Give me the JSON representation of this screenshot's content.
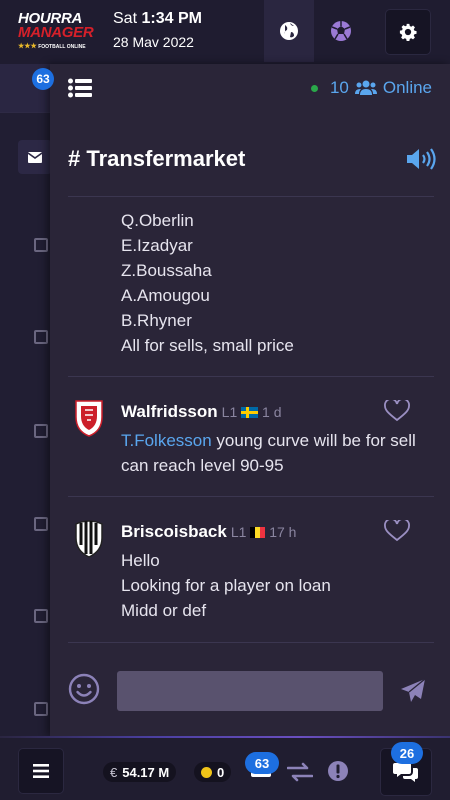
{
  "header": {
    "logo_line1": "HOURRA",
    "logo_line2": "MANAGER",
    "logo_tagline": "FOOTBALL ONLINE",
    "day": "Sat",
    "time": "1:34 PM",
    "date": "28 Mav 2022"
  },
  "sidebar": {
    "badge": "63"
  },
  "chat": {
    "online_count": "10",
    "online_label": "Online",
    "channel_title": "# Transfermarket",
    "messages": [
      {
        "lines": [
          {
            "text": "Q.Oberlin",
            "link": true
          },
          {
            "text": "E.Izadyar",
            "link": true
          },
          {
            "text": "Z.Boussaha",
            "link": true
          },
          {
            "text": "A.Amougou",
            "link": true
          },
          {
            "text": "B.Rhyner",
            "link": true
          },
          {
            "text": "All for sells, small price",
            "link": false
          }
        ]
      },
      {
        "author": "Walfridsson",
        "league": "L1",
        "flag": "sweden",
        "age": "1 d",
        "line1_link": "T.Folkesson",
        "line1_rest": " young curve will be for sell",
        "line2": "can reach level 90-95"
      },
      {
        "author": "Briscoisback",
        "league": "L1",
        "flag": "belgium",
        "age": "17 h",
        "line1": "Hello",
        "line2": "Looking for a player on loan",
        "line3": "Midd or def"
      }
    ],
    "input_placeholder": ""
  },
  "bottombar": {
    "money_currency": "€",
    "money": "54.17 M",
    "coins": "0",
    "inbox_badge": "63",
    "chat_badge": "26"
  },
  "colors": {
    "accent_blue": "#5aa6ee",
    "badge_blue": "#1d6fe0",
    "panel_bg": "#2a2538"
  }
}
